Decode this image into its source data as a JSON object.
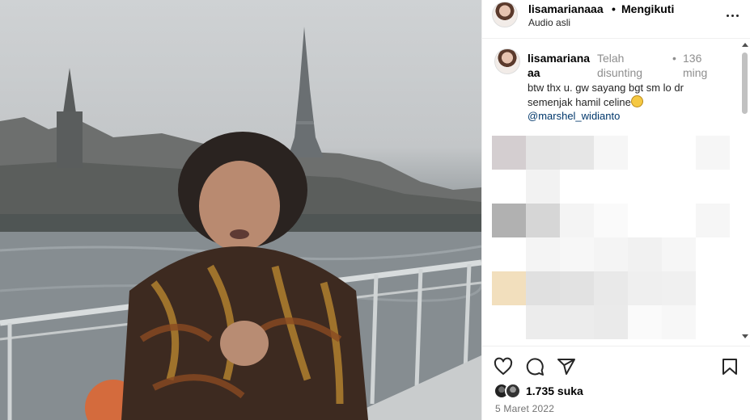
{
  "header": {
    "username": "lisamarianaaa",
    "separator": "•",
    "follow_status": "Mengikuti",
    "audio": "Audio asli"
  },
  "comment": {
    "username": "lisamarianaaa",
    "edited": "Telah disunting",
    "dot": "•",
    "time": "136 ming",
    "text": "btw thx u. gw sayang bgt sm lo dr semenjak hamil celine",
    "emoji": "grinning-sweat-emoji",
    "mention": "@marshel_widianto"
  },
  "actions": {
    "icons": [
      "heart-icon",
      "comment-icon",
      "share-icon",
      "bookmark-icon"
    ],
    "likes": "1.735 suka",
    "date": "5 Maret 2022"
  },
  "mosaic_colors": [
    [
      "#d4ced0",
      "#e4e4e4",
      "#e6e6e6",
      "#f6f6f6",
      "#ffffff",
      "#ffffff",
      "#f6f6f6"
    ],
    [
      "#ffffff",
      "#f2f2f2",
      "#ffffff",
      "#ffffff",
      "#ffffff",
      "#ffffff",
      "#ffffff"
    ],
    [
      "#b1b1b1",
      "#d6d6d6",
      "#f4f4f4",
      "#fafafa",
      "#ffffff",
      "#ffffff",
      "#f6f6f6"
    ],
    [
      "#ffffff",
      "#f4f4f4",
      "#f7f7f7",
      "#f4f4f4",
      "#f1f1f1",
      "#f6f6f6",
      "#ffffff"
    ],
    [
      "#f2dfbd",
      "#e0e0e0",
      "#e2e2e2",
      "#e9e9e9",
      "#efefef",
      "#f0f0f0",
      "#ffffff"
    ],
    [
      "#ffffff",
      "#ececec",
      "#ececec",
      "#eaeaea",
      "#fafafa",
      "#f7f7f7",
      "#ffffff"
    ]
  ]
}
